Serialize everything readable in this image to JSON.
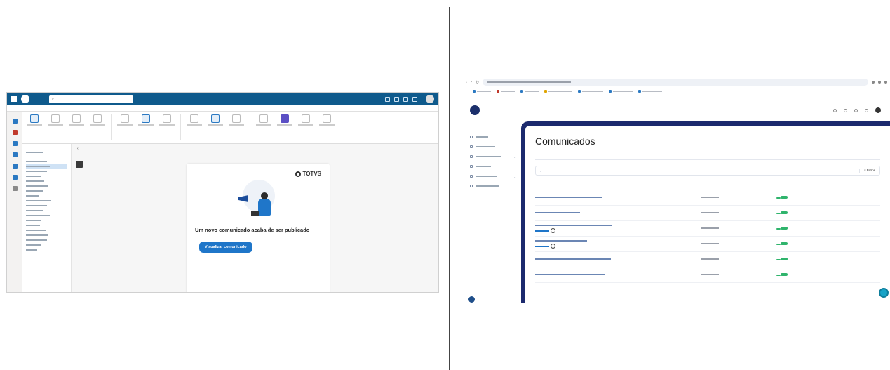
{
  "left_outlook": {
    "title_brand": "",
    "title_toggle": "",
    "search_placeholder": "",
    "user_name": "",
    "tabs": [
      "",
      "",
      "",
      ""
    ],
    "status_text": "",
    "reading_header": "",
    "card": {
      "brand_left": "",
      "brand_right": "TOTVS",
      "title": "Um novo comunicado acaba de ser publicado",
      "subtitle": "",
      "button_label": "Visualizar comunicado",
      "link_text": ""
    }
  },
  "right_browser": {
    "page_title": "Comunicados",
    "page_description": "",
    "tabs": [
      "",
      ""
    ],
    "search_placeholder": "",
    "filter_label": "Filtros",
    "table": {
      "columns": [
        "",
        "",
        ""
      ],
      "rows": [
        {
          "name": "",
          "date": "",
          "status": "",
          "sub": ""
        },
        {
          "name": "",
          "date": "",
          "status": "",
          "sub": ""
        },
        {
          "name": "",
          "date": "",
          "status": "",
          "sub": ""
        },
        {
          "name": "",
          "date": "",
          "status": "",
          "sub": ""
        },
        {
          "name": "",
          "date": "",
          "status": "",
          "sub": ""
        },
        {
          "name": "",
          "date": "",
          "status": "",
          "sub": ""
        }
      ]
    },
    "colors": {
      "frame": "#1c2a6e",
      "accent": "#1f76c9",
      "status_green": "#2fb46c"
    }
  }
}
